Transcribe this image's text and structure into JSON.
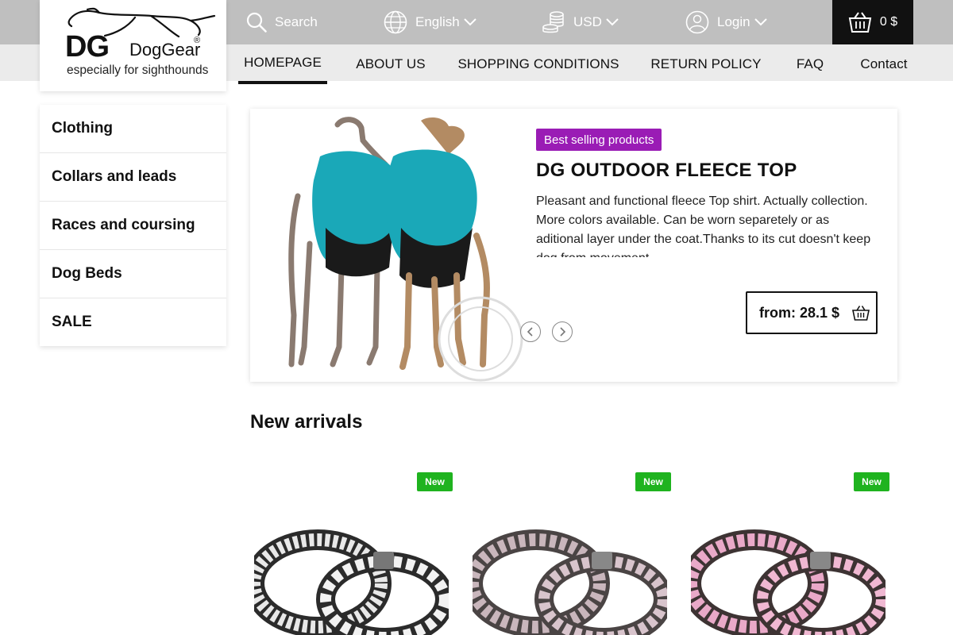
{
  "brand": {
    "logo_mark": "DG",
    "name": "DogGear",
    "registered": "®",
    "tagline": "especially for sighthounds"
  },
  "topbar": {
    "search_label": "Search",
    "language": "English",
    "currency": "USD",
    "login": "Login",
    "cart_total": "0 $"
  },
  "nav": {
    "items": [
      {
        "label": "HOMEPAGE",
        "active": true
      },
      {
        "label": "ABOUT US"
      },
      {
        "label": "SHOPPING CONDITIONS"
      },
      {
        "label": "RETURN POLICY"
      },
      {
        "label": "FAQ"
      },
      {
        "label": "Contact"
      }
    ]
  },
  "sidebar": {
    "items": [
      {
        "label": "Clothing"
      },
      {
        "label": "Collars and leads"
      },
      {
        "label": "Races and coursing"
      },
      {
        "label": "Dog Beds"
      },
      {
        "label": "SALE"
      }
    ]
  },
  "hero": {
    "badge": "Best selling products",
    "title": "DG OUTDOOR FLEECE TOP",
    "description": "Pleasant and functional fleece Top shirt. Actually collection. More colors available.   Can be worn separetely or as aditional layer under the coat.Thanks to its cut doesn't keep dog from movement.",
    "price": "from: 28.1 $",
    "colors": {
      "badge": "#9a1cb5",
      "fleece": "#1aa8b8"
    }
  },
  "new_arrivals": {
    "title": "New arrivals",
    "badge": "New",
    "products": [
      {
        "pattern": "black-white baroque",
        "icon": "collar-image"
      },
      {
        "pattern": "grey pink blossom",
        "icon": "collar-image"
      },
      {
        "pattern": "pink floral",
        "icon": "collar-image"
      }
    ],
    "colors": {
      "badge": "#1fb31f"
    }
  }
}
